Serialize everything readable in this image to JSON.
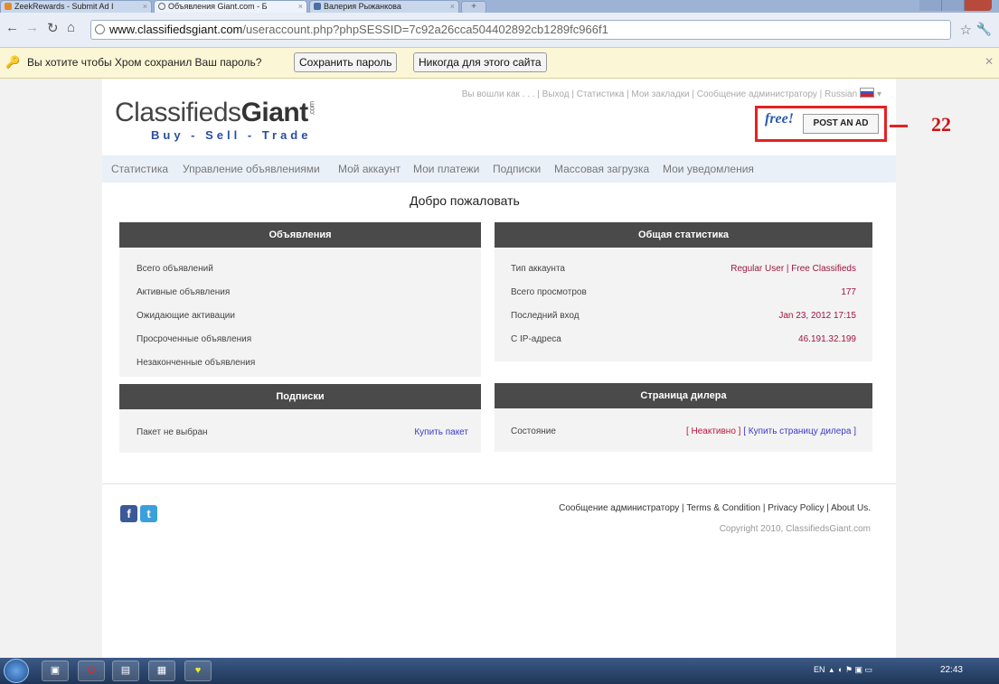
{
  "browser": {
    "tabs": [
      {
        "title": "ZeekRewards - Submit Ad I"
      },
      {
        "title": "Объявления Giant.com - Б"
      },
      {
        "title": "Валерия Рыжанкова"
      }
    ],
    "url_host": "www.classifiedsgiant.com",
    "url_rest": "/useraccount.php?phpSESSID=7c92a26cca504402892cb1289fc966f1",
    "infobar": {
      "message": "Вы хотите чтобы Хром сохранил Ваш пароль?",
      "save_label": "Сохранить пароль",
      "never_label": "Никогда для этого сайта"
    }
  },
  "site": {
    "logo_light": "Classifieds",
    "logo_bold": "Giant",
    "logo_com": ".com",
    "tagline": "Buy - Sell - Trade",
    "toplinks": "Вы вошли как . . . | Выход | Статистика | Мои закладки | Сообщение администратору | Russian",
    "post_free": "free!",
    "post_label": "POST AN AD",
    "nav": [
      "Статистика",
      "Управление объявлениями",
      "Мой аккаунт",
      "Мои платежи",
      "Подписки",
      "Массовая загрузка",
      "Мои уведомления"
    ],
    "welcome": "Добро пожаловать",
    "ads_box": {
      "title": "Объявления",
      "rows": [
        "Всего объявлений",
        "Активные объявления",
        "Ожидающие активации",
        "Просроченные объявления",
        "Незаконченные объявления"
      ]
    },
    "stats_box": {
      "title": "Общая статистика",
      "rows": [
        {
          "label": "Тип аккаунта",
          "value": "Regular User | Free Classifieds"
        },
        {
          "label": "Всего просмотров",
          "value": "177"
        },
        {
          "label": "Последний вход",
          "value": "Jan 23, 2012 17:15"
        },
        {
          "label": "С IP-адреса",
          "value": "46.191.32.199"
        }
      ]
    },
    "subs_box": {
      "title": "Подписки",
      "label": "Пакет не выбран",
      "link": "Купить пакет"
    },
    "dealer_box": {
      "title": "Страница дилера",
      "label": "Состояние",
      "inactive": "[ Неактивно ]",
      "buy": "[ Купить страницу дилера ]"
    },
    "footer_links": "Сообщение администратору | Terms & Condition | Privacy Policy | About Us.",
    "copyright": "Copyright 2010, ClassifiedsGiant.com"
  },
  "annotation": {
    "number": "22"
  },
  "taskbar": {
    "lang": "EN",
    "time": "22:43"
  },
  "colors": {
    "accent_red": "#e52222",
    "header_dark": "#4a4a4a",
    "value_red": "#a0153e",
    "link_blue": "#3a3ac8"
  }
}
